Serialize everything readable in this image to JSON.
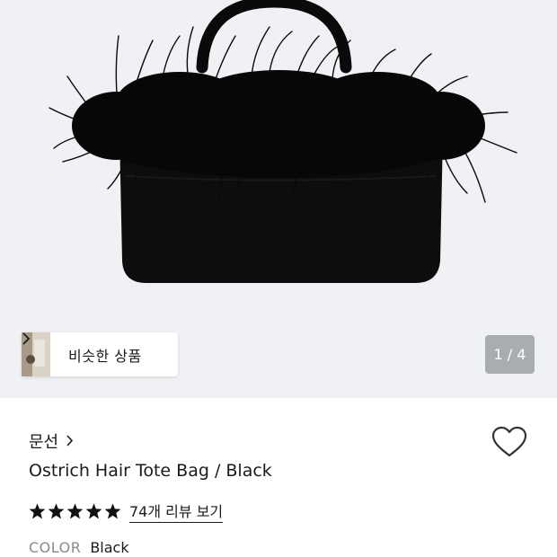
{
  "similar_button": {
    "label": "비슷한 상품"
  },
  "pager": {
    "text": "1 / 4"
  },
  "product": {
    "brand": "문선",
    "name": "Ostrich Hair Tote Bag / Black",
    "rating": 5,
    "reviews_link": "74개 리뷰 보기",
    "color_label": "COLOR",
    "color_value": "Black"
  },
  "colors": {
    "hero_bg": "#eff1f4",
    "bag": "#0d0d0d",
    "text": "#1a1a1a",
    "muted": "#8a8a8a"
  },
  "icons": [
    "chevron-right-icon",
    "heart-outline-icon",
    "star-icon"
  ]
}
